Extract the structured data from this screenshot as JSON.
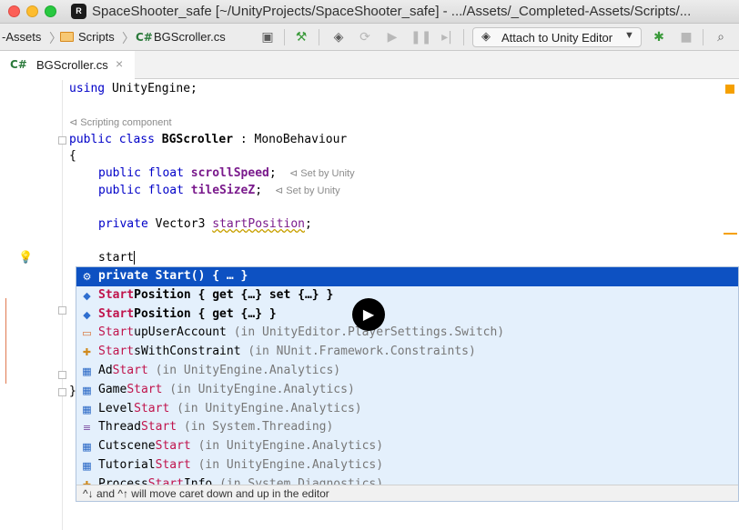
{
  "window": {
    "title": "SpaceShooter_safe [~/UnityProjects/SpaceShooter_safe] - .../Assets/_Completed-Assets/Scripts/...",
    "app_icon_label": "R"
  },
  "navbar": {
    "crumbs": [
      "-Assets",
      "Scripts",
      "BGScroller.cs"
    ],
    "cs_badge": "C#",
    "attach_label": "Attach to Unity Editor"
  },
  "tabs": [
    {
      "badge": "C#",
      "label": "BGScroller.cs",
      "close": "×"
    }
  ],
  "code": {
    "line1_kw": "using",
    "line1_rest": " UnityEngine;",
    "component_hint": "Scripting component",
    "class_kw": "public class ",
    "class_name": "BGScroller",
    "class_rest": " : MonoBehaviour",
    "open_brace": "{",
    "field1_kw": "public float ",
    "field1_name": "scrollSpeed",
    "field1_end": ";",
    "field1_hint": "Set by Unity",
    "field2_kw": "public float ",
    "field2_name": "tileSizeZ",
    "field2_end": ";",
    "field2_hint": "Set by Unity",
    "field3_kw": "private ",
    "field3_type": "Vector3 ",
    "field3_name": "startPosition",
    "field3_end": ";",
    "typing": "start",
    "close_brace": "}"
  },
  "completion": {
    "items": [
      {
        "icon": "⚙",
        "pre": "",
        "match": "",
        "text": "private Start() { … }",
        "ctx": "",
        "bold": true
      },
      {
        "icon": "◆",
        "pre": "",
        "match": "Start",
        "text": "Position { get {…} set {…} }",
        "ctx": "",
        "bold": true
      },
      {
        "icon": "◆",
        "pre": "",
        "match": "Start",
        "text": "Position { get {…} }",
        "ctx": "",
        "bold": true
      },
      {
        "icon": "▭",
        "pre": "",
        "match": "Start",
        "text": "upUserAccount",
        "ctx": " (in UnityEditor.PlayerSettings.Switch)",
        "bold": false
      },
      {
        "icon": "✚",
        "pre": "",
        "match": "Start",
        "text": "sWithConstraint",
        "ctx": " (in NUnit.Framework.Constraints)",
        "bold": false
      },
      {
        "icon": "▦",
        "pre": "Ad",
        "match": "Start",
        "text": "",
        "ctx": " (in UnityEngine.Analytics)",
        "bold": false
      },
      {
        "icon": "▦",
        "pre": "Game",
        "match": "Start",
        "text": "",
        "ctx": " (in UnityEngine.Analytics)",
        "bold": false
      },
      {
        "icon": "▦",
        "pre": "Level",
        "match": "Start",
        "text": "",
        "ctx": " (in UnityEngine.Analytics)",
        "bold": false
      },
      {
        "icon": "≡",
        "pre": "Thread",
        "match": "Start",
        "text": "",
        "ctx": " (in System.Threading)",
        "bold": false
      },
      {
        "icon": "▦",
        "pre": "Cutscene",
        "match": "Start",
        "text": "",
        "ctx": " (in UnityEngine.Analytics)",
        "bold": false
      },
      {
        "icon": "▦",
        "pre": "Tutorial",
        "match": "Start",
        "text": "",
        "ctx": " (in UnityEngine.Analytics)",
        "bold": false
      },
      {
        "icon": "✚",
        "pre": "Process",
        "match": "Start",
        "text": "Info",
        "ctx": " (in System.Diagnostics)",
        "bold": false
      }
    ],
    "footer": "^↓ and ^↑ will move caret down and up in the editor"
  },
  "colors": {
    "selection": "#0d51c2",
    "match": "#c0144c",
    "popup_bg": "#e4f0fc"
  }
}
